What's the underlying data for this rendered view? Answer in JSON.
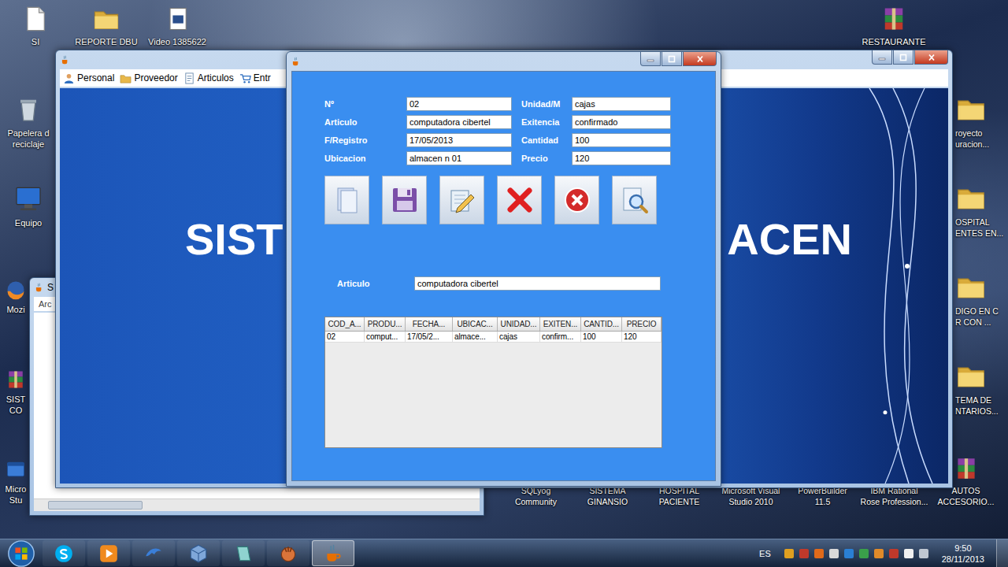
{
  "desktop": {
    "top_row": [
      {
        "kind": "file",
        "lines": [
          "SI"
        ]
      },
      {
        "kind": "folder",
        "lines": [
          "REPORTE DBU"
        ]
      },
      {
        "kind": "video",
        "lines": [
          "Video 1385622"
        ]
      }
    ],
    "top_right": [
      {
        "kind": "archive",
        "lines": [
          "RESTAURANTE"
        ]
      }
    ],
    "left_column": [
      {
        "kind": "recycle",
        "lines": [
          "Papelera d",
          "reciclaje"
        ]
      },
      {
        "kind": "computer",
        "lines": [
          "Equipo"
        ]
      },
      {
        "kind": "browser",
        "lines": [
          "Mozi"
        ]
      },
      {
        "kind": "archive",
        "lines": [
          "SIST",
          "CO"
        ]
      },
      {
        "kind": "app",
        "lines": [
          "Micro",
          "Stu"
        ]
      }
    ],
    "right_column": [
      {
        "kind": "folder",
        "lines": [
          "royecto",
          "uracion..."
        ]
      },
      {
        "kind": "folder",
        "lines": [
          "OSPITAL",
          "ENTES EN..."
        ]
      },
      {
        "kind": "folder",
        "lines": [
          "DIGO EN C",
          "R CON ..."
        ]
      },
      {
        "kind": "folder",
        "lines": [
          "TEMA DE",
          "NTARIOS..."
        ]
      }
    ],
    "bottom_row": [
      {
        "kind": "app",
        "lines": [
          "SQLyog",
          "Community"
        ]
      },
      {
        "kind": "app",
        "lines": [
          "SISTEMA",
          "GINANSIO"
        ]
      },
      {
        "kind": "app",
        "lines": [
          "HOSPITAL",
          "PACIENTE"
        ]
      },
      {
        "kind": "app",
        "lines": [
          "Microsoft Visual",
          "Studio 2010"
        ]
      },
      {
        "kind": "app",
        "lines": [
          "PowerBuilder",
          "11.5"
        ]
      },
      {
        "kind": "app",
        "lines": [
          "IBM Rational",
          "Rose Profession..."
        ]
      },
      {
        "kind": "archive",
        "lines": [
          "AUTOS",
          "ACCESORIO..."
        ]
      }
    ]
  },
  "back_window": {
    "title": "S",
    "menu": [
      "Arc"
    ]
  },
  "main_window": {
    "menu": [
      {
        "kind": "person",
        "label": "Personal"
      },
      {
        "kind": "folder",
        "label": "Proveedor"
      },
      {
        "kind": "document",
        "label": "Articulos"
      },
      {
        "kind": "cart",
        "label": "Entr"
      }
    ],
    "banner_left": "SIST",
    "banner_right": "ACEN"
  },
  "dialog": {
    "form": {
      "left": [
        {
          "label": "Nº",
          "value": "02"
        },
        {
          "label": "Articulo",
          "value": "computadora cibertel"
        },
        {
          "label": "F/Registro",
          "value": "17/05/2013"
        },
        {
          "label": "Ubicacion",
          "value": "almacen n 01"
        }
      ],
      "right": [
        {
          "label": "Unidad/M",
          "value": "cajas"
        },
        {
          "label": "Exitencia",
          "value": "confirmado"
        },
        {
          "label": "Cantidad",
          "value": "100"
        },
        {
          "label": "Precio",
          "value": "120"
        }
      ]
    },
    "toolbar": [
      {
        "kind": "new"
      },
      {
        "kind": "save"
      },
      {
        "kind": "edit"
      },
      {
        "kind": "delete"
      },
      {
        "kind": "cancel"
      },
      {
        "kind": "search"
      }
    ],
    "search": {
      "label": "Articulo",
      "value": "computadora cibertel"
    },
    "table": {
      "columns": [
        "COD_A...",
        "PRODU...",
        "FECHA...",
        "UBICAC...",
        "UNIDAD...",
        "EXITEN...",
        "CANTID...",
        "PRECIO"
      ],
      "rows": [
        [
          "02",
          "comput...",
          "17/05/2...",
          "almace...",
          "cajas",
          "confirm...",
          "100",
          "120"
        ]
      ]
    }
  },
  "taskbar": {
    "buttons": [
      {
        "kind": "skype",
        "active": false
      },
      {
        "kind": "media",
        "active": false
      },
      {
        "kind": "dolphin",
        "active": false
      },
      {
        "kind": "box",
        "active": false
      },
      {
        "kind": "note",
        "active": false
      },
      {
        "kind": "glove",
        "active": false
      },
      {
        "kind": "java",
        "active": true
      }
    ],
    "language": "ES",
    "time": "9:50",
    "date": "28/11/2013"
  }
}
